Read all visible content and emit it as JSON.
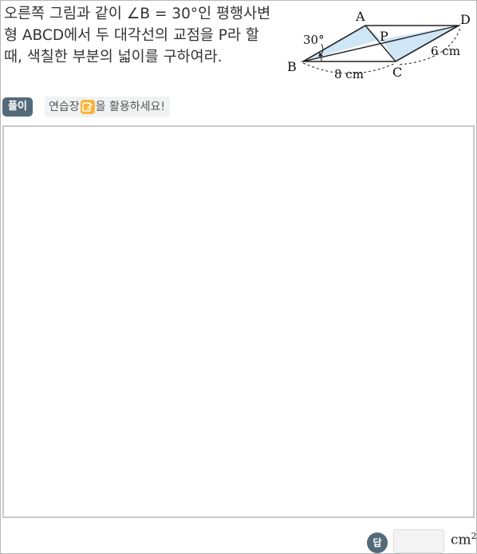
{
  "question": {
    "text": "오른쪽 그림과 같이 ∠B = 30°인 평행사변형 ABCD에서 두 대각선의 교점을 P라 할 때, 색칠한 부분의 넓이를 구하여라."
  },
  "figure": {
    "label_A": "A",
    "label_B": "B",
    "label_C": "C",
    "label_D": "D",
    "label_P": "P",
    "angle_label": "30°",
    "bottom_length": "8 cm",
    "side_length": "6 cm",
    "shade_color": "#cfe6f7"
  },
  "controls": {
    "solve_label": "풀이",
    "practice_before": "연습장",
    "practice_icon": "pencil-note-icon",
    "practice_after": "을 활용하세요!",
    "answer_label": "답",
    "answer_value": "",
    "unit": "cm",
    "unit_power": "2"
  }
}
